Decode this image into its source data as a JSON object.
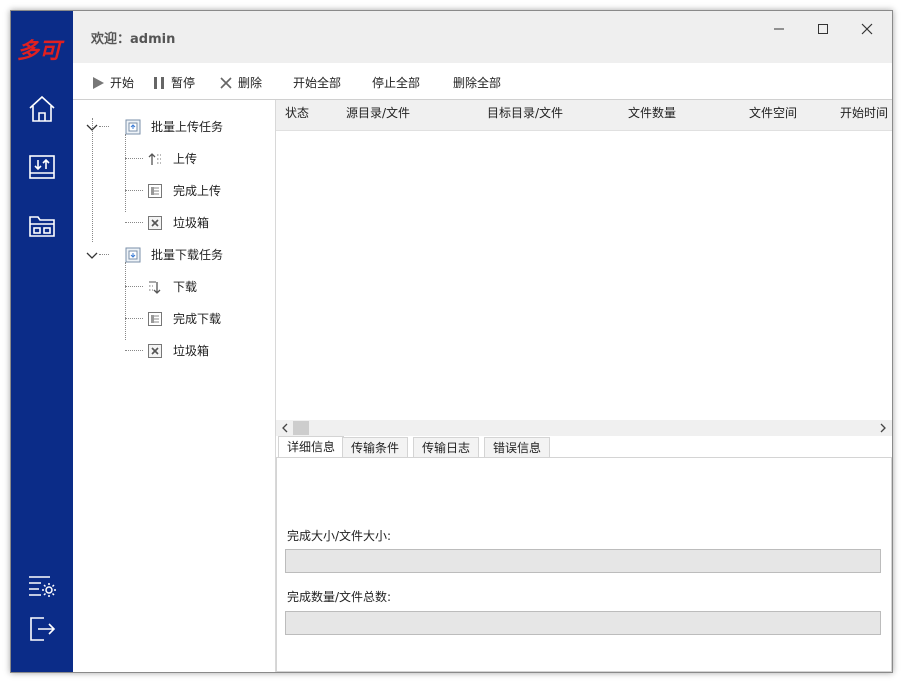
{
  "app": {
    "logo_text": "多可",
    "welcome_label": "欢迎：",
    "user": "admin"
  },
  "sidebar": {
    "buttons": [
      {
        "name": "home-icon"
      },
      {
        "name": "transfer-icon"
      },
      {
        "name": "folders-icon"
      },
      {
        "name": "settings-icon"
      },
      {
        "name": "logout-icon"
      }
    ]
  },
  "window_controls": [
    "minimize-icon",
    "maximize-icon",
    "close-icon"
  ],
  "toolbar": {
    "start": "开始",
    "pause": "暂停",
    "delete": "删除",
    "start_all": "开始全部",
    "stop_all": "停止全部",
    "delete_all": "删除全部"
  },
  "tree": {
    "upload_group": "批量上传任务",
    "upload_items": [
      "上传",
      "完成上传",
      "垃圾箱"
    ],
    "download_group": "批量下载任务",
    "download_items": [
      "下载",
      "完成下载",
      "垃圾箱"
    ]
  },
  "grid": {
    "columns": [
      "状态",
      "源目录/文件",
      "目标目录/文件",
      "文件数量",
      "文件空间",
      "开始时间"
    ],
    "rows": []
  },
  "tabs": [
    "详细信息",
    "传输条件",
    "传输日志",
    "错误信息"
  ],
  "details": {
    "size_label": "完成大小/文件大小:",
    "count_label": "完成数量/文件总数:",
    "size_progress": 0,
    "count_progress": 0
  },
  "colors": {
    "sidebar": "#0b2c88",
    "logo": "#e02020"
  }
}
